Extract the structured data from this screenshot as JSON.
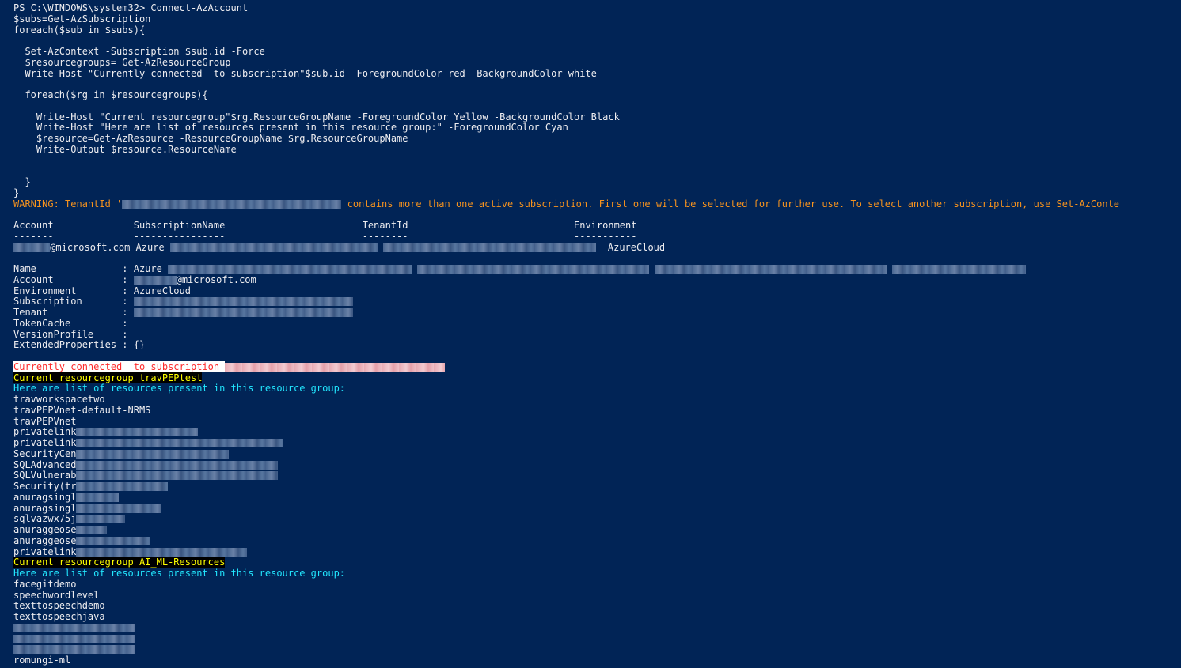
{
  "window": {
    "app": "Windows PowerShell",
    "colors": {
      "background": "#012456",
      "text": "#eeedf0",
      "warning": "#f7931e",
      "red_fg": "#ff2b2b",
      "red_bg": "#ffffff",
      "yellow_fg": "#ffff00",
      "yellow_bg": "#000000",
      "cyan": "#22e7ff"
    }
  },
  "console": {
    "lines": [
      [
        {
          "text": "PS C:\\WINDOWS\\system32> Connect-AzAccount"
        }
      ],
      [
        {
          "text": "$subs=Get-AzSubscription"
        }
      ],
      [
        {
          "text": "foreach($sub in $subs){"
        }
      ],
      [
        {
          "text": ""
        }
      ],
      [
        {
          "text": "  Set-AzContext -Subscription $sub.id -Force"
        }
      ],
      [
        {
          "text": "  $resourcegroups= Get-AzResourceGroup"
        }
      ],
      [
        {
          "text": "  Write-Host \"Currently connected  to subscription\"$sub.id -ForegroundColor red -BackgroundColor white"
        }
      ],
      [
        {
          "text": ""
        }
      ],
      [
        {
          "text": "  foreach($rg in $resourcegroups){"
        }
      ],
      [
        {
          "text": ""
        }
      ],
      [
        {
          "text": "    Write-Host \"Current resourcegroup\"$rg.ResourceGroupName -ForegroundColor Yellow -BackgroundColor Black"
        }
      ],
      [
        {
          "text": "    Write-Host \"Here are list of resources present in this resource group:\" -ForegroundColor Cyan"
        }
      ],
      [
        {
          "text": "    $resource=Get-AzResource -ResourceGroupName $rg.ResourceGroupName"
        }
      ],
      [
        {
          "text": "    Write-Output $resource.ResourceName"
        }
      ],
      [
        {
          "text": ""
        }
      ],
      [
        {
          "text": ""
        }
      ],
      [
        {
          "text": "  }"
        }
      ],
      [
        {
          "text": "}"
        }
      ],
      [
        {
          "text": "WARNING: TenantId '",
          "style": "warning"
        },
        {
          "redact": 36
        },
        {
          "text": " contains more than one active subscription. First one will be selected for further use. To select another subscription, use Set-AzConte",
          "style": "warning"
        }
      ],
      [
        {
          "text": ""
        }
      ],
      [
        {
          "text": "Account              SubscriptionName                        TenantId                             Environment"
        }
      ],
      [
        {
          "text": "-------              ----------------                        --------                             -----------"
        }
      ],
      [
        {
          "redact": 6
        },
        {
          "text": "@microsoft.com Azure "
        },
        {
          "redact": 34
        },
        {
          "text": " "
        },
        {
          "redact": 35
        },
        {
          "text": "  AzureCloud"
        }
      ],
      [
        {
          "text": ""
        }
      ],
      [
        {
          "text": "Name               : Azure "
        },
        {
          "redact": 40
        },
        {
          "text": " "
        },
        {
          "redact": 38
        },
        {
          "text": " "
        },
        {
          "redact": 38
        },
        {
          "text": " "
        },
        {
          "redact": 22
        }
      ],
      [
        {
          "text": "Account            : "
        },
        {
          "redact": 7
        },
        {
          "text": "@microsoft.com"
        }
      ],
      [
        {
          "text": "Environment        : AzureCloud"
        }
      ],
      [
        {
          "text": "Subscription       : "
        },
        {
          "redact": 36
        }
      ],
      [
        {
          "text": "Tenant             : "
        },
        {
          "redact": 36
        }
      ],
      [
        {
          "text": "TokenCache         :"
        }
      ],
      [
        {
          "text": "VersionProfile     :"
        }
      ],
      [
        {
          "text": "ExtendedProperties : {}"
        }
      ],
      [
        {
          "text": ""
        }
      ],
      [
        {
          "text": "Currently connected  to subscription ",
          "style": "red"
        },
        {
          "redact": 36,
          "light": true
        }
      ],
      [
        {
          "text": "Current resourcegroup travPEPtest",
          "style": "yellow"
        }
      ],
      [
        {
          "text": "Here are list of resources present in this resource group:",
          "style": "cyan"
        }
      ],
      [
        {
          "text": "travworkspacetwo"
        }
      ],
      [
        {
          "text": "travPEPVnet-default-NRMS"
        }
      ],
      [
        {
          "text": "travPEPVnet"
        }
      ],
      [
        {
          "text": "privatelink"
        },
        {
          "redact": 20
        }
      ],
      [
        {
          "text": "privatelink"
        },
        {
          "redact": 34
        }
      ],
      [
        {
          "text": "SecurityCen"
        },
        {
          "redact": 25
        }
      ],
      [
        {
          "text": "SQLAdvanced"
        },
        {
          "redact": 33
        }
      ],
      [
        {
          "text": "SQLVulnerab"
        },
        {
          "redact": 33
        }
      ],
      [
        {
          "text": "Security(tr"
        },
        {
          "redact": 15
        }
      ],
      [
        {
          "text": "anuragsingl"
        },
        {
          "redact": 7
        }
      ],
      [
        {
          "text": "anuragsingl"
        },
        {
          "redact": 14
        }
      ],
      [
        {
          "text": "sqlvazwx75j"
        },
        {
          "redact": 8
        }
      ],
      [
        {
          "text": "anuraggeose"
        },
        {
          "redact": 5
        }
      ],
      [
        {
          "text": "anuraggeose"
        },
        {
          "redact": 12
        }
      ],
      [
        {
          "text": "privatelink"
        },
        {
          "redact": 28
        }
      ],
      [
        {
          "text": "Current resourcegroup AI_ML-Resources",
          "style": "yellow"
        }
      ],
      [
        {
          "text": "Here are list of resources present in this resource group:",
          "style": "cyan"
        }
      ],
      [
        {
          "text": "facegitdemo"
        }
      ],
      [
        {
          "text": "speechwordlevel"
        }
      ],
      [
        {
          "text": "texttospeechdemo"
        }
      ],
      [
        {
          "text": "texttospeechjava"
        }
      ],
      [
        {
          "redact": 20
        }
      ],
      [
        {
          "redact": 20
        }
      ],
      [
        {
          "redact": 20
        }
      ],
      [
        {
          "text": "romungi-ml"
        }
      ]
    ]
  }
}
